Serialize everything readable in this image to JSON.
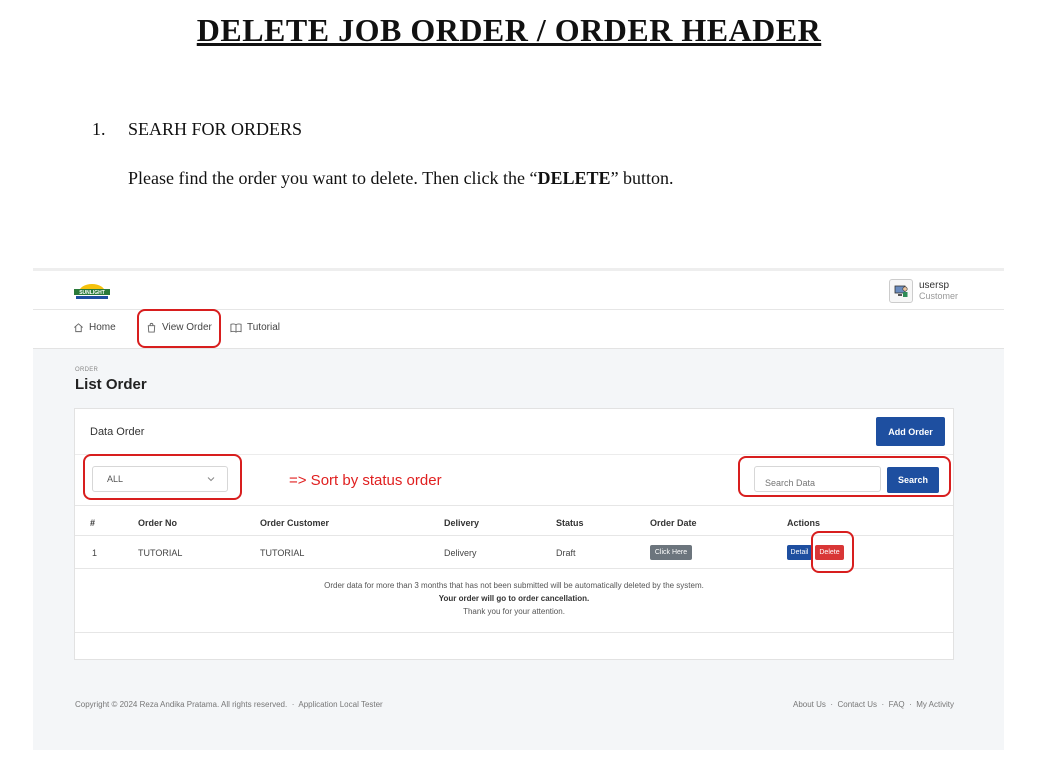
{
  "doc": {
    "title": "DELETE JOB ORDER / ORDER HEADER",
    "step_number": "1.",
    "step_title": "SEARH FOR ORDERS",
    "instruction_pre": "Please find the order you want to delete. Then click the “",
    "instruction_bold": "DELETE",
    "instruction_post": "” button."
  },
  "app": {
    "logo": "SUNLIGHT",
    "user": {
      "name": "usersp",
      "role": "Customer"
    },
    "nav": [
      {
        "label": "Home",
        "icon": "home-icon"
      },
      {
        "label": "View Order",
        "icon": "shopping-bag-icon"
      },
      {
        "label": "Tutorial",
        "icon": "book-icon"
      }
    ],
    "breadcrumb": "ORDER",
    "page_title": "List Order",
    "card": {
      "title": "Data Order",
      "add_button": "Add Order",
      "filter_value": "ALL",
      "sort_note": "=> Sort by status order",
      "search_placeholder": "Search Data",
      "search_button": "Search"
    },
    "table": {
      "headers": [
        "#",
        "Order No",
        "Order Customer",
        "Delivery",
        "Status",
        "Order Date",
        "Actions"
      ],
      "rows": [
        {
          "num": "1",
          "order_no": "TUTORIAL",
          "customer": "TUTORIAL",
          "delivery": "Delivery",
          "status": "Draft",
          "order_date_button": "Click Here",
          "detail": "Detail",
          "delete": "Delete"
        }
      ]
    },
    "notice": {
      "line1": "Order data for more than 3 months that has not been submitted will be automatically deleted by the system.",
      "line2": "Your order will go to order cancellation.",
      "line3": "Thank you for your attention."
    },
    "footer": {
      "copyright": "Copyright © 2024 Reza Andika Pratama. All rights reserved.",
      "sep": "·",
      "tester": "Application Local Tester",
      "links": [
        "About Us",
        "Contact Us",
        "FAQ",
        "My Activity"
      ]
    },
    "colors": {
      "primary": "#1e4fa0",
      "danger": "#d93636",
      "highlight": "#d81e1e"
    }
  }
}
